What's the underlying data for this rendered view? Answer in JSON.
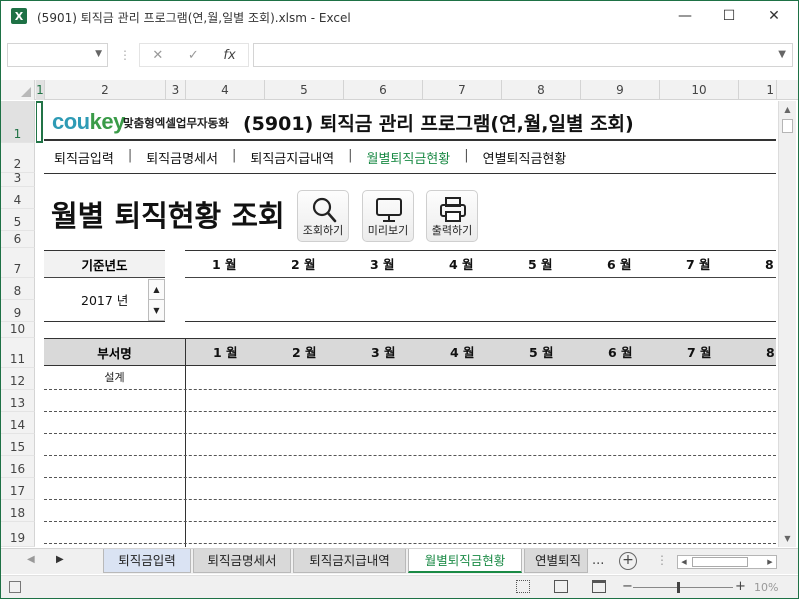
{
  "window": {
    "app_icon": "X",
    "title": "(5901) 퇴직금 관리 프로그램(연,월,일별 조회).xlsm - Excel",
    "minimize": "—",
    "maximize": "☐",
    "close": "✕"
  },
  "formula_bar": {
    "name_box": "",
    "cancel": "✕",
    "enter": "✓",
    "fx": "fx",
    "value": ""
  },
  "columns": [
    "1",
    "2",
    "3",
    "4",
    "5",
    "6",
    "7",
    "8",
    "9",
    "10",
    "1"
  ],
  "rows": [
    "1",
    "2",
    "3",
    "4",
    "5",
    "6",
    "7",
    "8",
    "9",
    "10",
    "11",
    "12",
    "13",
    "14",
    "15",
    "16",
    "17",
    "18",
    "19"
  ],
  "sheet": {
    "logo_cou": "cou",
    "logo_key": "key",
    "logo_sub": "맞춤형엑셀업무자동화",
    "program_title": "(5901) 퇴직금 관리 프로그램(연,월,일별 조회)",
    "menu": [
      "퇴직금입력",
      "퇴직금명세서",
      "퇴직금지급내역",
      "월별퇴직금현황",
      "연별퇴직금현황"
    ],
    "active_menu": "월별퇴직금현황",
    "page_title": "월별 퇴직현황 조회",
    "buttons": {
      "search": "조회하기",
      "preview": "미리보기",
      "print": "출력하기"
    },
    "year_label": "기준년도",
    "year_value": "2017 년",
    "spin_up": "▲",
    "spin_down": "▼",
    "months": [
      "1 월",
      "2 월",
      "3 월",
      "4 월",
      "5 월",
      "6 월",
      "7 월",
      "8"
    ],
    "dept_label": "부서명",
    "departments": [
      "설계",
      "",
      "",
      "",
      "",
      "",
      "",
      ""
    ]
  },
  "tabs": {
    "prev": "◀",
    "next": "▶",
    "items": [
      "퇴직금입력",
      "퇴직금명세서",
      "퇴직금지급내역",
      "월별퇴직금현황",
      "연별퇴직"
    ],
    "active": "월별퇴직금현황",
    "more": "...",
    "add": "+"
  },
  "status": {
    "zoom_minus": "−",
    "zoom_plus": "+",
    "zoom": "10%"
  }
}
